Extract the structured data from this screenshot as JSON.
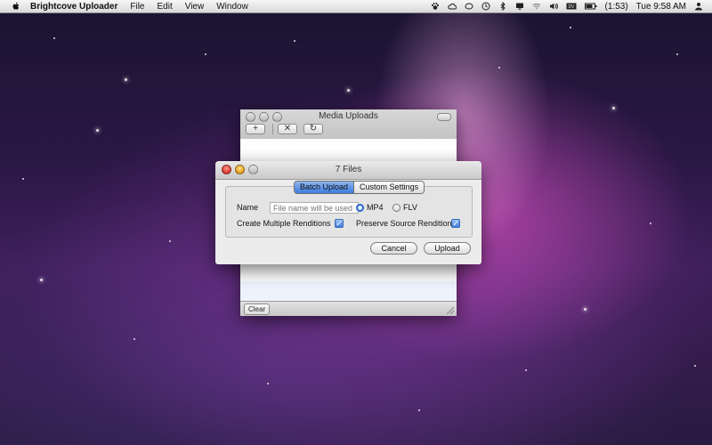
{
  "menubar": {
    "app_name": "Brightcove Uploader",
    "menus": [
      "File",
      "Edit",
      "View",
      "Window"
    ],
    "battery": "(1:53)",
    "clock": "Tue 9:58 AM",
    "icons": [
      "apple-icon",
      "paw-icon",
      "cloud-icon",
      "display-icon",
      "clock-icon",
      "bluetooth-icon",
      "monitor-icon",
      "wifi-icon",
      "volume-icon",
      "keyboard-icon",
      "battery-icon",
      "user-icon"
    ]
  },
  "media_window": {
    "title": "Media Uploads",
    "toolbar": {
      "add": "+",
      "remove": "✕",
      "refresh": "↻"
    },
    "clear_label": "Clear"
  },
  "dialog": {
    "title": "7 Files",
    "tabs": [
      "Batch Upload",
      "Custom Settings"
    ],
    "active_tab": "Batch Upload",
    "name_label": "Name",
    "name_placeholder": "File name will be used",
    "formats": [
      "MP4",
      "FLV"
    ],
    "selected_format": "MP4",
    "create_multiple_renditions": "Create Multiple Renditions",
    "preserve_source_rendition": "Preserve Source Rendition",
    "cancel_label": "Cancel",
    "upload_label": "Upload"
  }
}
